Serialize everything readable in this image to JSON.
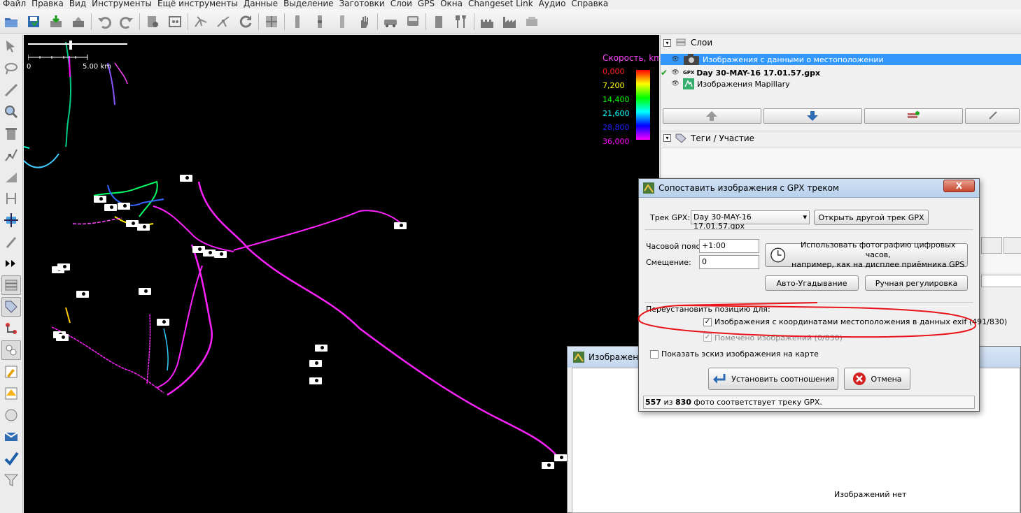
{
  "menu": [
    "Файл",
    "Правка",
    "Вид",
    "Инструменты",
    "Ещё инструменты",
    "Данные",
    "Выделение",
    "Заготовки",
    "Слои",
    "GPS",
    "Окна",
    "Changeset Link",
    "Аудио",
    "Справка"
  ],
  "toolbar_icons": [
    "open-icon",
    "save-icon",
    "download-icon",
    "upload-icon",
    "undo-icon",
    "redo-icon",
    "preferences-icon",
    "properties-icon",
    "wireframe-icon",
    "split-icon",
    "refresh-icon",
    "grid-icon",
    "bar1-icon",
    "bar2-icon",
    "bar3-icon",
    "hand-icon",
    "car-icon",
    "bus-icon",
    "shop-icon",
    "restaurant-icon",
    "castle-icon",
    "factory-icon",
    "camera-toolbar-icon"
  ],
  "left_tools": [
    "select-icon",
    "lasso-icon",
    "draw-icon",
    "zoom-icon",
    "delete-icon",
    "node-icon",
    "area-icon",
    "improve-way-icon",
    "move-icon",
    "pencil-icon",
    "more-icon",
    "layers-toggle-icon",
    "tags-toggle-icon",
    "relations-icon",
    "selection-list-icon",
    "author-icon",
    "validator-icon",
    "conflict-icon",
    "imagery-icon",
    "todo-icon",
    "filter-icon"
  ],
  "map": {
    "scale_zero": "0",
    "scale_dist": "5.00 km",
    "legend_title": "Скорость, km",
    "legend_values": [
      {
        "text": "0,000",
        "color": "#ff2020"
      },
      {
        "text": "7,200",
        "color": "#ffff00"
      },
      {
        "text": "14,400",
        "color": "#00ff00"
      },
      {
        "text": "21,600",
        "color": "#00ffff"
      },
      {
        "text": "28,800",
        "color": "#2020ff"
      },
      {
        "text": "36,000",
        "color": "#ff00ff"
      }
    ]
  },
  "layers_panel": {
    "title": "Слои",
    "items": [
      {
        "name": "Изображения с данными о местоположении",
        "selected": true
      },
      {
        "name": "Day 30-MAY-16 17.01.57.gpx",
        "prefix": "GPX",
        "bold": true
      },
      {
        "name": "Изображения Mapillary"
      }
    ]
  },
  "tags_panel": {
    "title": "Теги / Участие"
  },
  "dialog": {
    "title": "Сопоставить изображения с GPX треком",
    "close_label": "X",
    "gpx_label": "Трек GPX:",
    "gpx_value": "Day 30-MAY-16 17.01.57.gpx",
    "open_other": "Открыть другой трек GPX",
    "tz_label": "Часовой пояс:",
    "tz_value": "+1:00",
    "offset_label": "Смещение:",
    "offset_value": "0",
    "clock_btn_line1": "Использовать фотографию цифровых часов,",
    "clock_btn_line2": "например, как на дисплее приёмника GPS",
    "auto_guess": "Авто-Угадывание",
    "manual_adjust": "Ручная регулировка",
    "reposition_label": "Переустановить позицию для:",
    "exif_label": "Изображения с координатами местоположения в данных exif (491/830)",
    "tagged_label": "Помечено изображений (0/830)",
    "thumb_label": "Показать эскиз изображения на карте",
    "apply": "Установить соотношения",
    "cancel": "Отмена",
    "status_a": "557",
    "status_mid": " из ",
    "status_b": "830",
    "status_end": " фото соответствует треку GPX."
  },
  "image_window": {
    "title": "Изображени",
    "empty": "Изображений нет"
  }
}
